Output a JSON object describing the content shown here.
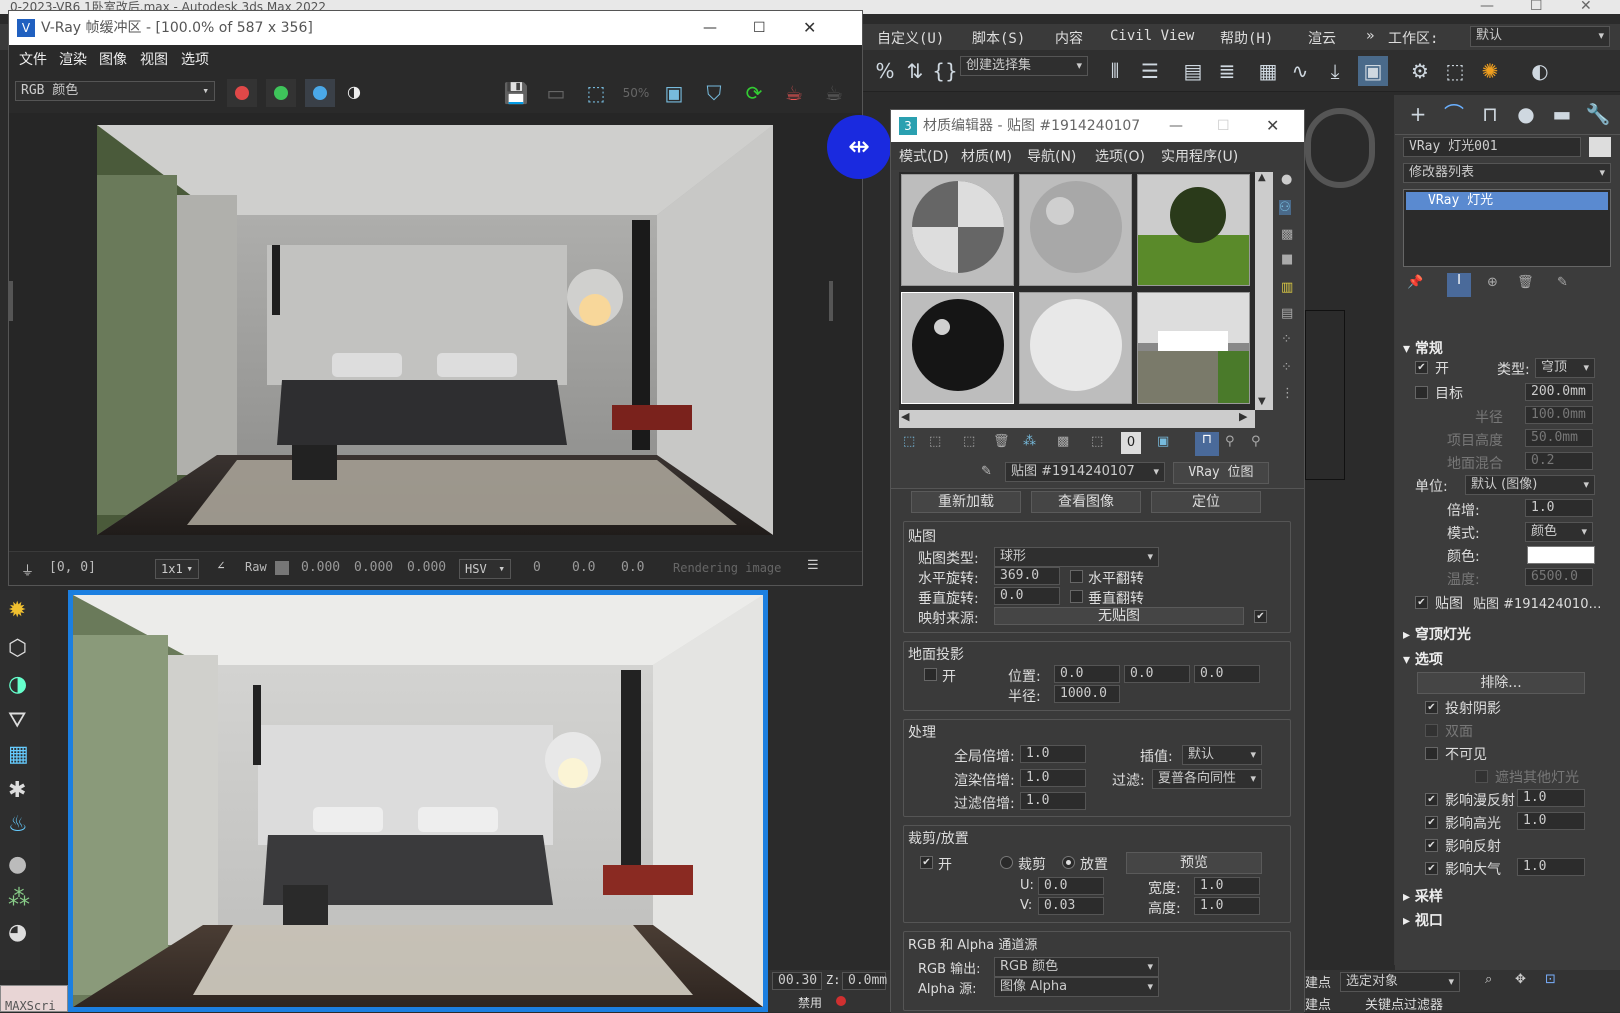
{
  "max": {
    "title": "0-2023-VR6 1卧室改后.max - Autodesk 3ds Max 2022",
    "menu": [
      "自定义(U)",
      "脚本(S)",
      "内容",
      "Civil View",
      "帮助(H)",
      "渲云"
    ],
    "workspace_label": "工作区:",
    "workspace_value": "默认",
    "selection_set": "创建选择集",
    "selected_obj": "选定对象",
    "bottom_left": "MAXScri",
    "coords": {
      "x_val": "00.30",
      "z_label": "Z:",
      "z_val": "0.0mm"
    },
    "auto_key": "禁用",
    "keyfilter": "关键点过滤器",
    "point_label": "建点",
    "point_label2": "建点"
  },
  "cmd": {
    "object_name": "VRay 灯光001",
    "modifier_list": "修改器列表",
    "stack_item": "VRay 灯光",
    "general": "常规",
    "on": "开",
    "type_label": "类型:",
    "type_value": "穹顶",
    "target": "目标",
    "target_value": "200.0mm",
    "half_len": "半径",
    "half_val": "100.0mm",
    "item_height": "项目高度",
    "item_val": "50.0mm",
    "ground_blend": "地面混合",
    "ground_val": "0.2",
    "units_label": "单位:",
    "units_value": "默认 (图像)",
    "multiplier": "倍增:",
    "mult_val": "1.0",
    "mode": "模式:",
    "mode_val": "颜色",
    "color": "颜色:",
    "temp": "温度:",
    "temp_val": "6500.0",
    "texture": "贴图",
    "texture_val": "贴图 #191424010…",
    "dome_roll": "穹顶灯光",
    "options_roll": "选项",
    "exclude": "排除...",
    "cast_shadows": "投射阴影",
    "double_sided": "双面",
    "invisible": "不可见",
    "occlude": "遮挡其他灯光",
    "affect_diffuse": "影响漫反射",
    "aff_diff_val": "1.0",
    "affect_spec": "影响高光",
    "aff_spec_val": "1.0",
    "affect_refl": "影响反射",
    "affect_atmo": "影响大气",
    "aff_atmo_val": "1.0",
    "sampling": "采样",
    "viewport": "视口"
  },
  "vfb": {
    "title": "V-Ray 帧缓冲区 - [100.0% of 587 x 356]",
    "menu": [
      "文件",
      "渲染",
      "图像",
      "视图",
      "选项"
    ],
    "channel": "RGB 颜色",
    "status": {
      "coords": "[0, 0]",
      "sample": "1x1",
      "raw": "Raw",
      "r": "0.000",
      "g": "0.000",
      "b": "0.000",
      "mode": "HSV",
      "h": "0",
      "s": "0.0",
      "v": "0.0",
      "msg": "Rendering image"
    },
    "colors": {
      "red": "#e04848",
      "green": "#3ec45a",
      "blue": "#4aa8e8"
    }
  },
  "mtl": {
    "title": "材质编辑器 - 贴图 #1914240107",
    "menu": [
      "模式(D)",
      "材质(M)",
      "导航(N)",
      "选项(O)",
      "实用程序(U)"
    ],
    "map_name": "贴图 #1914240107",
    "map_type": "VRay 位图",
    "reload": "重新加载",
    "view_image": "查看图像",
    "locate": "定位",
    "mapping": {
      "section": "贴图",
      "type_label": "贴图类型:",
      "type_val": "球形",
      "h_rot": "水平旋转:",
      "h_rot_val": "369.0",
      "h_flip": "水平翻转",
      "v_rot": "垂直旋转:",
      "v_rot_val": "0.0",
      "v_flip": "垂直翻转",
      "source": "映射来源:",
      "source_val": "无贴图"
    },
    "ground": {
      "section": "地面投影",
      "on": "开",
      "pos": "位置:",
      "px": "0.0",
      "py": "0.0",
      "pz": "0.0",
      "radius": "半径:",
      "radius_val": "1000.0"
    },
    "processing": {
      "section": "处理",
      "global": "全局倍增:",
      "global_val": "1.0",
      "interp": "插值:",
      "interp_val": "默认",
      "render": "渲染倍增:",
      "render_val": "1.0",
      "filter": "过滤:",
      "filter_val": "夏普各向同性",
      "filter_mult": "过滤倍增:",
      "filter_mult_val": "1.0"
    },
    "crop": {
      "section": "裁剪/放置",
      "on": "开",
      "crop": "裁剪",
      "place": "放置",
      "preview": "预览",
      "u": "U:",
      "u_val": "0.0",
      "v": "V:",
      "v_val": "0.03",
      "w": "宽度:",
      "w_val": "1.0",
      "h": "高度:",
      "h_val": "1.0"
    },
    "channel": {
      "section": "RGB 和 Alpha 通道源",
      "rgb": "RGB 输出:",
      "rgb_val": "RGB 颜色",
      "alpha": "Alpha 源:",
      "alpha_val": "图像 Alpha"
    }
  }
}
